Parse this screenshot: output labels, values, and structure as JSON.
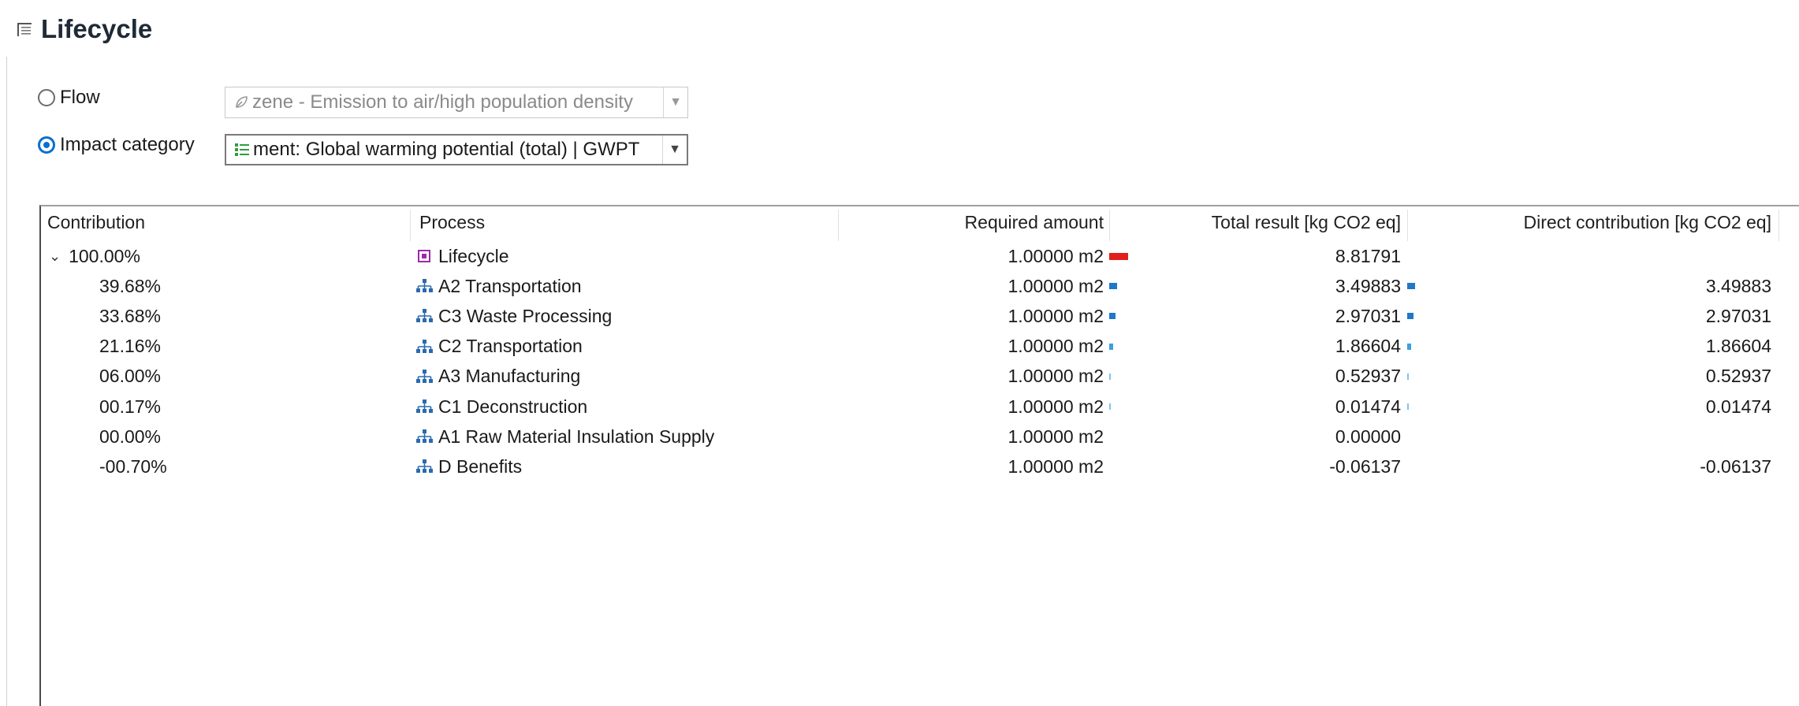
{
  "header": {
    "title": "Lifecycle",
    "icon": "editor-page-icon"
  },
  "selectors": {
    "flow": {
      "label": "Flow",
      "checked": false,
      "value": "zene - Emission to air/high population density",
      "icon": "flow-leaf-icon"
    },
    "impact": {
      "label": "Impact category",
      "checked": true,
      "value": "ment: Global warming potential (total) | GWPT",
      "icon": "impact-category-icon"
    }
  },
  "table": {
    "columns": {
      "contribution": "Contribution",
      "process": "Process",
      "required": "Required amount",
      "total": "Total result [kg CO2 eq]",
      "direct": "Direct contribution [kg CO2 eq]"
    },
    "rows": [
      {
        "contribution": "100.00%",
        "process": "Lifecycle",
        "icon": "product-system-icon",
        "required": "1.00000 m2",
        "total": "8.81791",
        "direct": "",
        "total_share": 1.0,
        "direct_share": 0,
        "bar_color": "#e0201b",
        "expanded": true
      },
      {
        "contribution": "39.68%",
        "process": "A2 Transportation",
        "icon": "process-tree-icon",
        "required": "1.00000 m2",
        "total": "3.49883",
        "direct": "3.49883",
        "total_share": 0.3968,
        "direct_share": 0.3968,
        "bar_color": "#1f78c8"
      },
      {
        "contribution": "33.68%",
        "process": "C3 Waste Processing",
        "icon": "process-tree-icon",
        "required": "1.00000 m2",
        "total": "2.97031",
        "direct": "2.97031",
        "total_share": 0.3368,
        "direct_share": 0.3368,
        "bar_color": "#1f78c8"
      },
      {
        "contribution": "21.16%",
        "process": "C2 Transportation",
        "icon": "process-tree-icon",
        "required": "1.00000 m2",
        "total": "1.86604",
        "direct": "1.86604",
        "total_share": 0.2116,
        "direct_share": 0.2116,
        "bar_color": "#3aa0e0"
      },
      {
        "contribution": "06.00%",
        "process": "A3 Manufacturing",
        "icon": "process-tree-icon",
        "required": "1.00000 m2",
        "total": "0.52937",
        "direct": "0.52937",
        "total_share": 0.06,
        "direct_share": 0.06,
        "bar_color": "#7cc6ef"
      },
      {
        "contribution": "00.17%",
        "process": "C1 Deconstruction",
        "icon": "process-tree-icon",
        "required": "1.00000 m2",
        "total": "0.01474",
        "direct": "0.01474",
        "total_share": 0.0017,
        "direct_share": 0.0017,
        "bar_color": "#7cc6ef"
      },
      {
        "contribution": "00.00%",
        "process": "A1 Raw Material Insulation Supply",
        "icon": "process-tree-icon",
        "required": "1.00000 m2",
        "total": "0.00000",
        "direct": "",
        "total_share": 0,
        "direct_share": 0,
        "bar_color": "#7cc6ef"
      },
      {
        "contribution": "-00.70%",
        "process": "D Benefits",
        "icon": "process-tree-icon",
        "required": "1.00000 m2",
        "total": "-0.06137",
        "direct": "-0.06137",
        "total_share": 0,
        "direct_share": 0,
        "bar_color": "#7cc6ef"
      }
    ]
  }
}
